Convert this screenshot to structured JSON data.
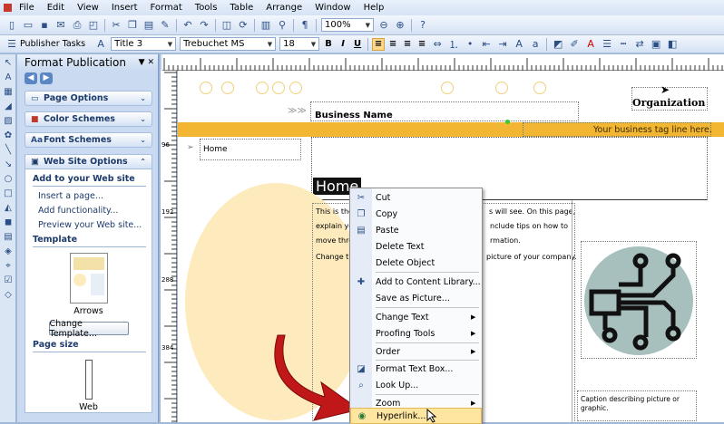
{
  "menu": {
    "items": [
      "File",
      "Edit",
      "View",
      "Insert",
      "Format",
      "Tools",
      "Table",
      "Arrange",
      "Window",
      "Help"
    ]
  },
  "toolbar": {
    "zoom": "100%",
    "publisher_tasks": "Publisher Tasks",
    "style": "Title 3",
    "font": "Trebuchet MS",
    "size": "18"
  },
  "taskpane": {
    "title": "Format Publication",
    "sections": [
      "Page Options",
      "Color Schemes",
      "Font Schemes"
    ],
    "web_section": "Web Site Options",
    "add_heading": "Add to your Web site",
    "links": [
      "Insert a page...",
      "Add functionality...",
      "Preview your Web site..."
    ],
    "template_heading": "Template",
    "template_name": "Arrows",
    "change_template": "Change Template...",
    "pagesize_heading": "Page size",
    "pagesize_name": "Web"
  },
  "rulers": {
    "v": [
      "96",
      "192",
      "288",
      "384"
    ]
  },
  "page": {
    "business_name": "Business Name",
    "organization": "Organization",
    "tagline": "Your business tag line here.",
    "nav_home": "Home",
    "heading": "Home",
    "body1": "This is the",
    "body1b": "s will see. On this page,",
    "body2": "explain yo",
    "body2b": "nclude tips on how to",
    "body3": "move thro",
    "body3b": "rmation.",
    "body4": "Change th",
    "body4b": "picture of your company.",
    "caption": "Caption describing picture or graphic."
  },
  "context_menu": {
    "items": [
      "Cut",
      "Copy",
      "Paste",
      "Delete Text",
      "Delete Object",
      "Add to Content Library...",
      "Save as Picture...",
      "Change Text",
      "Proofing Tools",
      "Order",
      "Format Text Box...",
      "Look Up...",
      "Zoom",
      "Hyperlink..."
    ]
  },
  "colors": {
    "accent": "#f2b632",
    "page_circle": "#fdebbd",
    "graphic_bg": "#a7bfbd"
  }
}
